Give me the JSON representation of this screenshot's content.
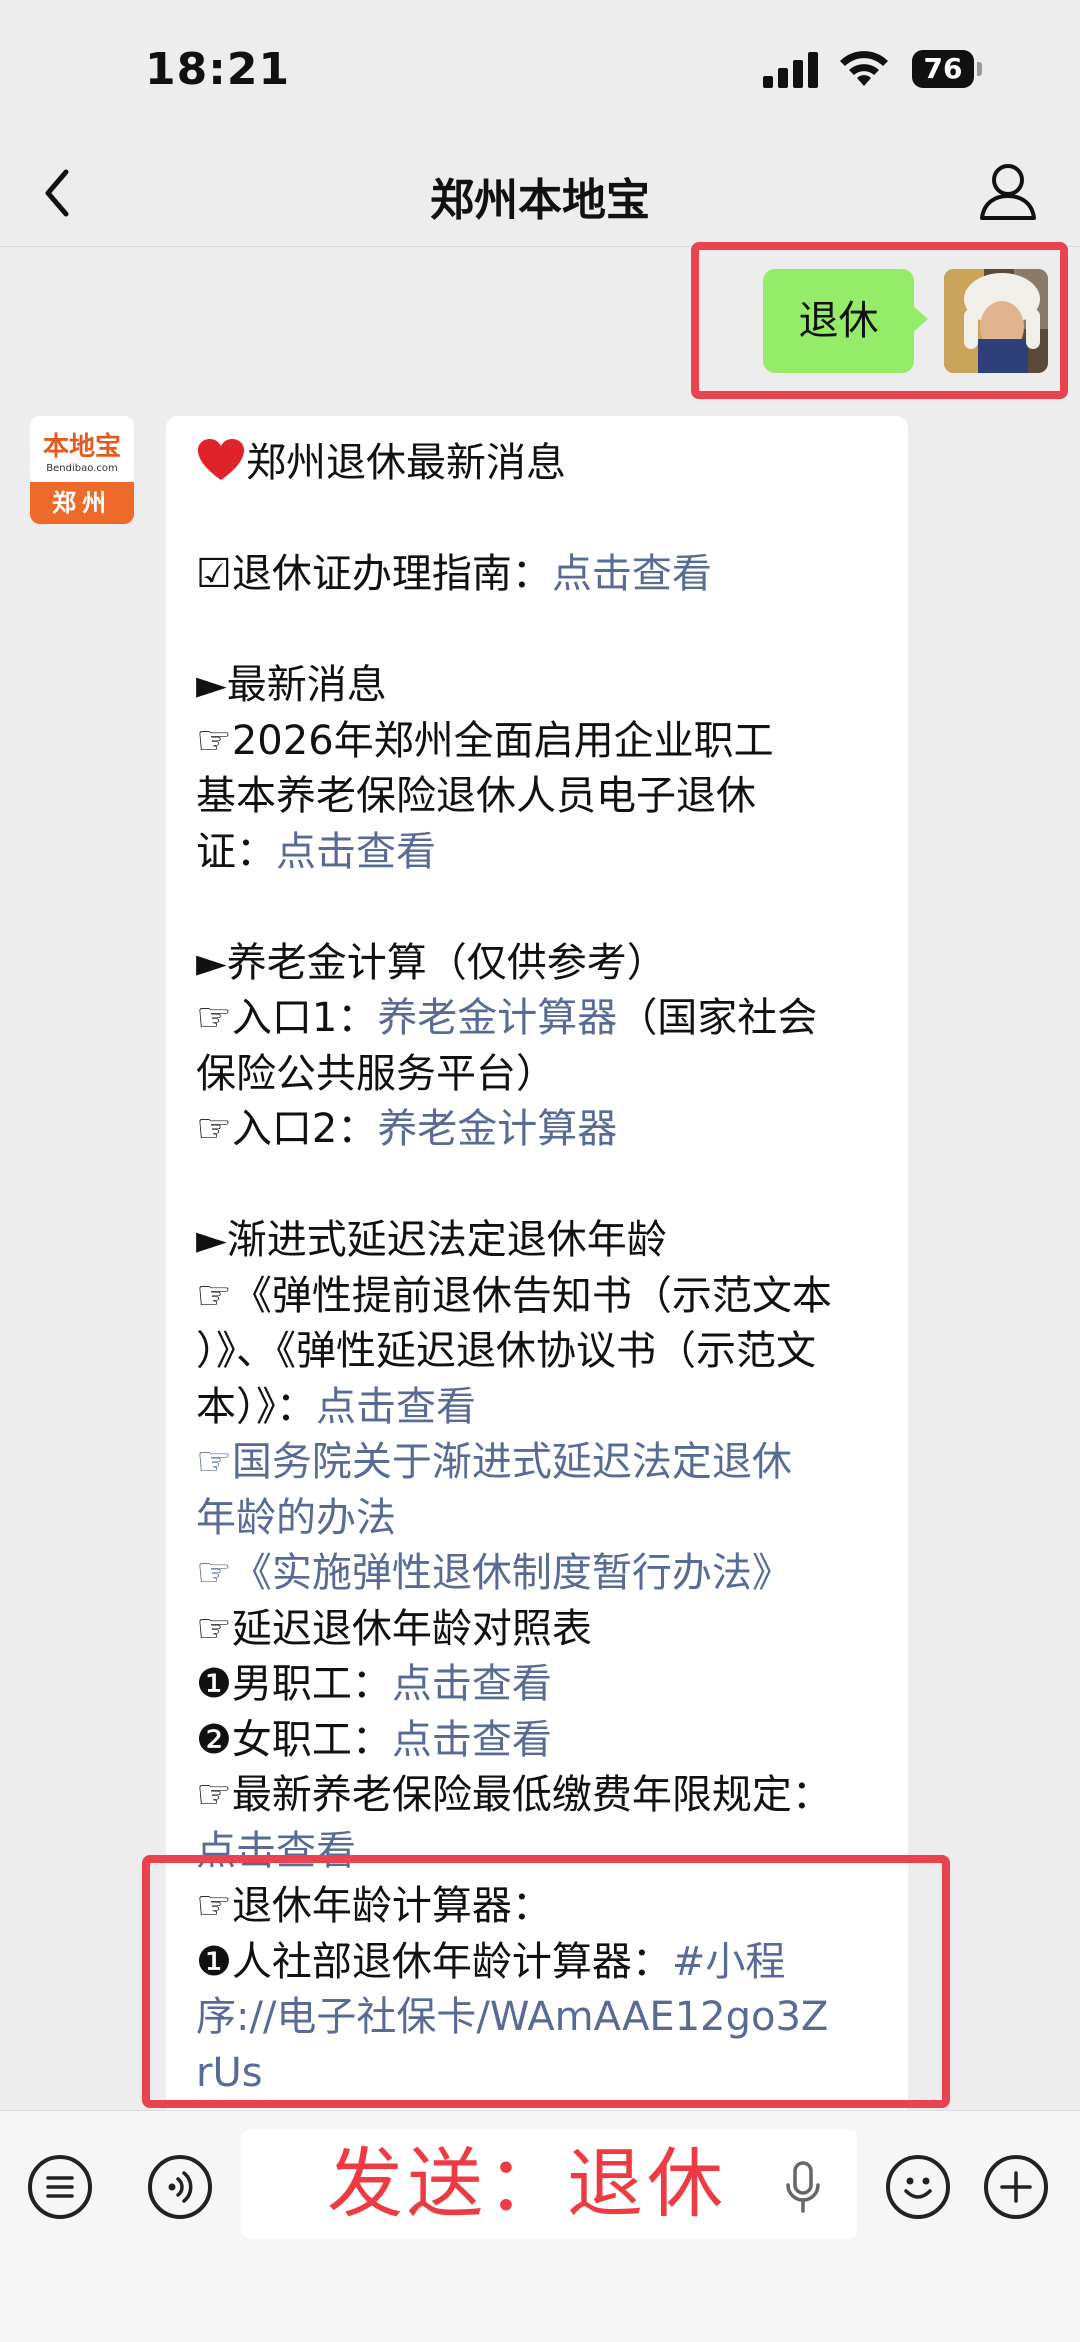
{
  "status_bar": {
    "time": "18:21",
    "battery": "76"
  },
  "nav": {
    "title": "郑州本地宝",
    "back_icon": "chevron-left-icon",
    "profile_icon": "person-icon"
  },
  "outgoing": {
    "text": "退休"
  },
  "bot": {
    "logo_text": "本地宝",
    "logo_url": "Bendibao.com",
    "logo_city": "郑州"
  },
  "message": {
    "heading": "郑州退休最新消息",
    "cert_label": "☑退休证办理指南：",
    "cert_link": "点击查看",
    "news_header": "►最新消息",
    "news_line1": "☞2026年郑州全面启用企业职工",
    "news_line2": "基本养老保险退休人员电子退休",
    "news_line3_prefix": "证：",
    "news_link": "点击查看",
    "pension_header": "►养老金计算（仅供参考）",
    "entry1_prefix": "☞入口1：",
    "entry1_link": "养老金计算器",
    "entry1_suffix": "（国家社会",
    "entry1_line2": "保险公共服务平台）",
    "entry2_prefix": "☞入口2：",
    "entry2_link": "养老金计算器",
    "delay_header": "►渐进式延迟法定退休年龄",
    "delay_line1": "☞《弹性提前退休告知书（示范文本",
    "delay_line2": "）》、《弹性延迟退休协议书（示范文",
    "delay_line3_prefix": "本）》：",
    "delay_link": "点击查看",
    "state_link_1": "☞国务院关于渐进式延迟法定退休",
    "state_link_2": "年龄的办法",
    "flex_link": "☞《实施弹性退休制度暂行办法》",
    "table_label": "☞延迟退休年龄对照表",
    "male_prefix": "❶男职工：",
    "male_link": "点击查看",
    "female_prefix": "❷女职工：",
    "female_link": "点击查看",
    "min_years_label": "☞最新养老保险最低缴费年限规定：",
    "min_years_link": "点击查看",
    "calc_label": "☞退休年龄计算器：",
    "calc_prefix": "❶人社部退休年龄计算器：",
    "calc_link1": "#小程",
    "calc_link2": "序://电子社保卡/WAmAAE12go3Z",
    "calc_link3": "rUs"
  },
  "input_bar": {
    "value": "发送：退休",
    "icons": [
      "menu-icon",
      "voice-icon",
      "mic-icon",
      "emoji-icon",
      "plus-icon"
    ]
  },
  "colors": {
    "link": "#576b95",
    "bubble_green": "#95ec69",
    "highlight_red": "#e8434f",
    "input_red": "#ee3b43"
  }
}
